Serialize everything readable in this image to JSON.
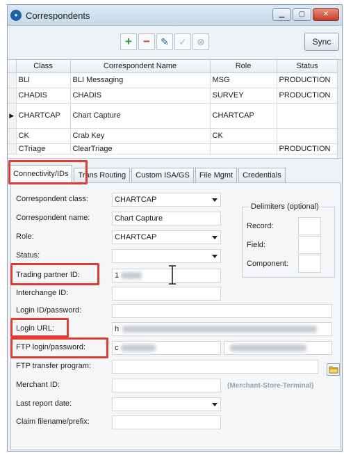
{
  "window": {
    "title": "Correspondents",
    "buttons": {
      "minimize": "▁",
      "maximize": "▢",
      "close": "✕"
    }
  },
  "toolbar": {
    "add_icon": "+",
    "remove_icon": "−",
    "edit_icon": "✎",
    "approve_icon": "✓",
    "cancel_icon": "⊗",
    "sync_label": "Sync"
  },
  "grid": {
    "columns": [
      "Class",
      "Correspondent Name",
      "Role",
      "Status"
    ],
    "rows": [
      {
        "indicator": "",
        "class": "BLI",
        "name": "BLI Messaging",
        "role": "MSG",
        "status": "PRODUCTION"
      },
      {
        "indicator": "",
        "class": "CHADIS",
        "name": "CHADIS",
        "role": "SURVEY",
        "status": "PRODUCTION"
      },
      {
        "indicator": "▶",
        "class": "CHARTCAP",
        "name": "Chart Capture",
        "role": "CHARTCAP",
        "status": ""
      },
      {
        "indicator": "",
        "class": "CK",
        "name": "Crab Key",
        "role": "CK",
        "status": ""
      },
      {
        "indicator": "",
        "class": "CTriage",
        "name": "ClearTriage",
        "role": "",
        "status": "PRODUCTION"
      }
    ]
  },
  "tabs": [
    "Connectivity/IDs",
    "Trans Routing",
    "Custom ISA/GS",
    "File Mgmt",
    "Credentials"
  ],
  "form": {
    "correspondent_class": {
      "label": "Correspondent class:",
      "value": "CHARTCAP"
    },
    "correspondent_name": {
      "label": "Correspondent name:",
      "value": "Chart Capture"
    },
    "role": {
      "label": "Role:",
      "value": "CHARTCAP"
    },
    "status": {
      "label": "Status:",
      "value": ""
    },
    "trading_partner_id": {
      "label": "Trading partner ID:",
      "value": "1"
    },
    "interchange_id": {
      "label": "Interchange ID:",
      "value": ""
    },
    "login_id_password": {
      "label": "Login ID/password:",
      "value": ""
    },
    "login_url": {
      "label": "Login URL:",
      "value": "h"
    },
    "ftp_login_password": {
      "label": "FTP login/password:",
      "value": "c"
    },
    "ftp_transfer_program": {
      "label": "FTP transfer program:",
      "value": ""
    },
    "merchant_id": {
      "label": "Merchant ID:",
      "value": "",
      "hint": "(Merchant-Store-Terminal)"
    },
    "last_report_date": {
      "label": "Last report date:",
      "value": ""
    },
    "claim_filename_prefix": {
      "label": "Claim filename/prefix:",
      "value": ""
    }
  },
  "delimiters": {
    "title": "Delimiters (optional)",
    "record_label": "Record:",
    "field_label": "Field:",
    "component_label": "Component:"
  },
  "colors": {
    "highlight": "#e23b30",
    "title_bar": "#c9d9ea",
    "close_button": "#c0412a",
    "add_green": "#2e9e2e",
    "remove_red": "#d23b3b"
  }
}
